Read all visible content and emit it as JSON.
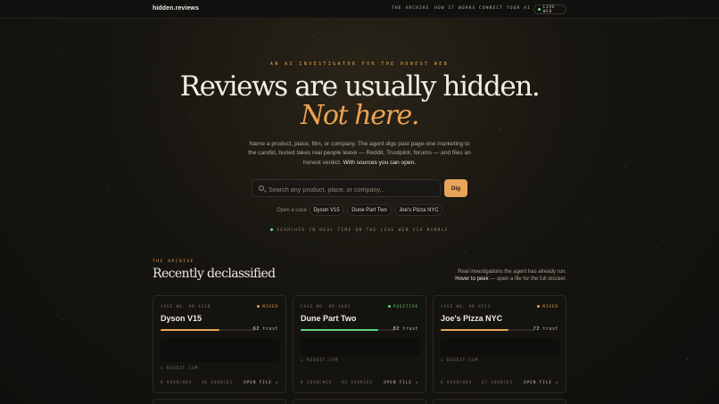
{
  "header": {
    "logo": "hidden.reviews",
    "nav": [
      "THE ARCHIVE",
      "HOW IT WORKS",
      "CONNECT YOUR AI"
    ],
    "live_badge": "LIVE WEB"
  },
  "hero": {
    "eyebrow": "AN AI INVESTIGATOR FOR THE HONEST WEB",
    "title_line1": "Reviews are usually hidden.",
    "title_line2": "Not here.",
    "lede": "Name a product, place, film, or company. The agent digs past page-one marketing to the candid, buried takes real people leave — Reddit, Trustpilot, forums — and files an honest verdict.",
    "lede_strong": "With sources you can open."
  },
  "search": {
    "placeholder": "Search any product, place, or company...",
    "button": "Dig"
  },
  "quick_cases": {
    "label": "Open a case",
    "items": [
      "Dyson V15",
      "Dune Part Two",
      "Joe's Pizza NYC"
    ]
  },
  "live_line": "SEARCHED IN REAL TIME ON THE LIVE WEB VIA NIMBLE",
  "archive": {
    "eyebrow": "THE ARCHIVE",
    "title": "Recently declassified",
    "note_line1": "Real investigations the agent has already run.",
    "note_strong": "Hover to peek",
    "note_line2": "— open a file for the full dossier."
  },
  "colors": {
    "accent": "#e7a55a",
    "mixed": "#e9a04d",
    "positive": "#5fd67d"
  },
  "cards": [
    {
      "case": "CASE NO. HR-1E1B",
      "verdict": "MIXED",
      "name": "Dyson V15",
      "trust_value": "62",
      "trust_label": "trust",
      "trust_fraction": 0.62,
      "source": "↳ REDDIT.COM",
      "footer": "8 SEARCHES · 36 SOURCES",
      "open": "OPEN FILE ↗"
    },
    {
      "case": "CASE NO. HR-A681",
      "verdict": "POSITIVE",
      "name": "Dune Part Two",
      "trust_value": "82",
      "trust_label": "trust",
      "trust_fraction": 0.82,
      "source": "↳ REDDIT.COM",
      "footer": "8 SEARCHES · 43 SOURCES",
      "open": "OPEN FILE ↗"
    },
    {
      "case": "CASE NO. HR-8713",
      "verdict": "MIXED",
      "name": "Joe's Pizza NYC",
      "trust_value": "72",
      "trust_label": "trust",
      "trust_fraction": 0.72,
      "source": "↳ REDDIT.COM",
      "footer": "8 SEARCHES · 37 SOURCES",
      "open": "OPEN FILE ↗"
    }
  ]
}
